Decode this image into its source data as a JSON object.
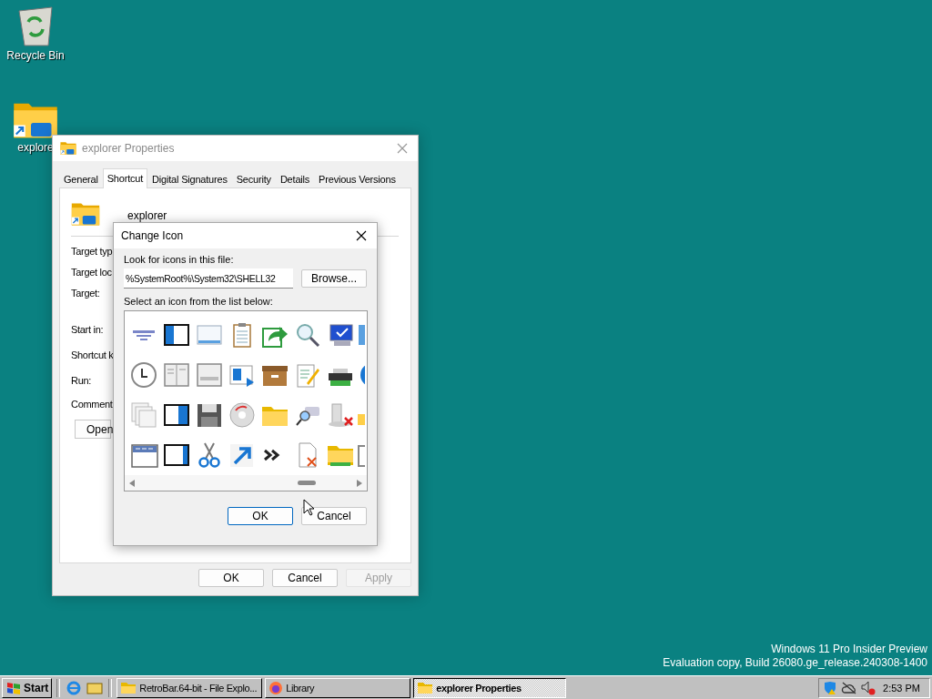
{
  "desktop": {
    "icons": [
      {
        "label": "Recycle Bin",
        "kind": "recycle"
      },
      {
        "label": "explore",
        "kind": "folder"
      }
    ],
    "version": [
      "Windows 11 Pro Insider Preview",
      "Evaluation copy, Build 26080.ge_release.240308-1400"
    ]
  },
  "properties": {
    "title": "explorer Properties",
    "tabs": [
      {
        "label": "General",
        "selected": false
      },
      {
        "label": "Shortcut",
        "selected": true
      },
      {
        "label": "Digital Signatures",
        "selected": false
      },
      {
        "label": "Security",
        "selected": false
      },
      {
        "label": "Details",
        "selected": false
      },
      {
        "label": "Previous Versions",
        "selected": false
      }
    ],
    "name": "explorer",
    "fields": [
      "Target typ",
      "Target loc",
      "Target:",
      "Start in:",
      "Shortcut k",
      "Run:",
      "Comment:"
    ],
    "open_button": "Open",
    "buttons": [
      {
        "label": "OK",
        "disabled": false
      },
      {
        "label": "Cancel",
        "disabled": false
      },
      {
        "label": "Apply",
        "disabled": true
      }
    ]
  },
  "change_icon": {
    "title": "Change Icon",
    "file_label": "Look for icons in this file:",
    "file_value": "%SystemRoot%\\System32\\SHELL32",
    "browse": "Browse...",
    "list_label": "Select an icon from the list below:",
    "buttons": [
      {
        "label": "OK",
        "default": true
      },
      {
        "label": "Cancel",
        "default": false
      }
    ]
  },
  "taskbar": {
    "start": "Start",
    "tasks": [
      {
        "label": "RetroBar.64-bit - File Explo...",
        "kind": "folder",
        "selected": false
      },
      {
        "label": "Library",
        "kind": "browser",
        "selected": false
      },
      {
        "label": "explorer Properties",
        "kind": "folder",
        "selected": true
      }
    ],
    "clock": "2:53 PM"
  }
}
